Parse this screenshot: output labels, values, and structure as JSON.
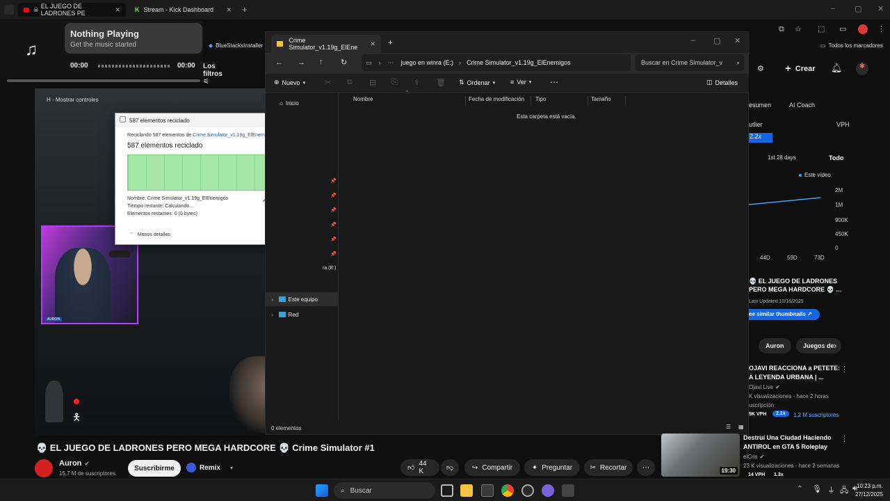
{
  "browser": {
    "tabs": [
      {
        "label": "EL JUEGO DE LADRONES PE"
      },
      {
        "label": "Stream - Kick Dashboard"
      }
    ],
    "bookmarks": {
      "bluestacks": "BlueStacksInstaller",
      "all_bookmarks": "Todos los marcadores"
    }
  },
  "music_widget": {
    "title": "Nothing Playing",
    "subtitle": "Get the music started",
    "time_start": "00:00",
    "time_end": "00:00",
    "filters_label": "Los filtros"
  },
  "video": {
    "overlay_hint": "H - Mostrar controles",
    "webcam_tag": "AURON"
  },
  "explorer": {
    "tab_title": "Crime Simulator_v1.19g_ElEne",
    "breadcrumb": [
      "juego en winra (E:)",
      "Crime Simulator_v1.19g_ElEnemigos"
    ],
    "search_placeholder": "Buscar en Crime Simulator_v",
    "toolbar": {
      "new": "Nuevo",
      "sort": "Ordenar",
      "view": "Ver",
      "details": "Detalles"
    },
    "sidebar": {
      "home": "Inicio",
      "drive_label": "ra (E:)",
      "this_pc": "Este equipo",
      "network": "Red"
    },
    "columns": [
      "Nombre",
      "Fecha de modificación",
      "Tipo",
      "Tamaño"
    ],
    "empty_message": "Esta carpeta está vacía.",
    "status": "0 elementos"
  },
  "dialog": {
    "title": "587 elementos reciclado",
    "recycling_prefix": "Reciclando 587 elementos de",
    "recycling_source": "Crime Simulator_v1.19g_ElEnemigos",
    "heading": "587 elementos reciclado",
    "progress": 1.0,
    "name_line": "Nombre:  Crime Simulator_v1.19g_ElEnemigos",
    "time_line": "Tiempo restante:  Calculando...",
    "remaining_line": "Elementos restantes:  0 (0 bytes)",
    "less_details": "Menos detalles"
  },
  "stream_page": {
    "title": "💀 EL JUEGO DE LADRONES PERO MEGA HARDCORE 💀 Crime Simulator #1",
    "channel": "Auron",
    "subscribers": "15,7 M de suscriptores",
    "subscribe": "Suscribirme",
    "remix": "Remix",
    "likes": "44 K",
    "share": "Compartir",
    "ask": "Preguntar",
    "clip": "Recortar"
  },
  "sidebar": {
    "create": "Crear",
    "tabs": [
      "esumen",
      "AI Coach",
      "VPH"
    ],
    "outlier_label": "utlier",
    "outlier_value": "2.2x",
    "range_label": "1st 28 days",
    "range_all": "Todo",
    "legend": "Este vídeo",
    "y_ticks": [
      "2M",
      "1M",
      "900K",
      "450K",
      "0"
    ],
    "x_ticks": [
      "44D",
      "59D",
      "73D"
    ],
    "video_title": "💀 EL JUEGO DE LADRONES PERO MEGA HARDCORE 💀 ...",
    "last_updated": "Last Updated 10/16/2025",
    "similar_button": "ee similar thumbnails ↗",
    "chips": [
      "Auron",
      "Juegos de"
    ],
    "rec1": {
      "title_line1": "OJAVI REACCIONA a PETETE:",
      "title_line2": "A LEYENDA URBANA | ...",
      "channel": "Ojavi Live",
      "views_line1": "K visualizaciones · hace 2 horas",
      "views_line2": "uscripción",
      "vph": "5K VPH",
      "multiplier": "2.1x",
      "subs": "1,2 M suscriptores"
    },
    "rec2": {
      "title_line1": "Destruí Una Ciudad Haciendo",
      "title_line2": "ANTIROL en GTA 5 Roleplay",
      "channel": "elCris",
      "views": "23 K visualizaciones · hace 2 semanas",
      "vph": "14 VPH",
      "multiplier": "1.3x",
      "duration": "19:30"
    }
  },
  "taskbar": {
    "search": "Buscar",
    "time": "10:23 p.m.",
    "date": "27/12/2025"
  }
}
